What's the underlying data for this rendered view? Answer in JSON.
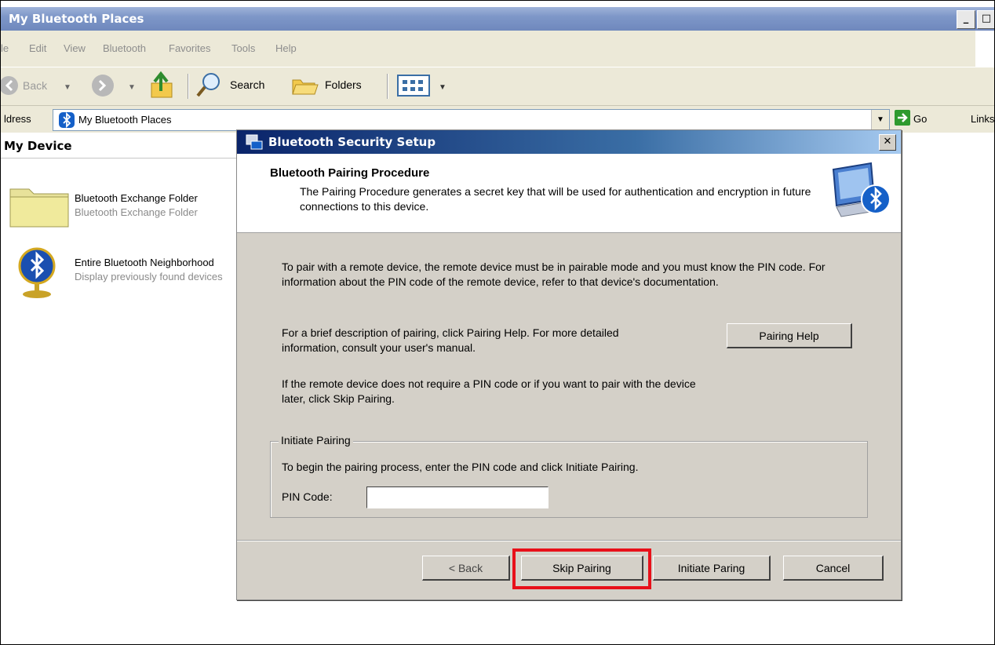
{
  "explorer": {
    "title": "My Bluetooth Places",
    "menu": [
      "le",
      "Edit",
      "View",
      "Bluetooth",
      "Favorites",
      "Tools",
      "Help"
    ],
    "toolbar": {
      "back": "Back",
      "search": "Search",
      "folders": "Folders"
    },
    "address": {
      "label": "ldress",
      "value": "My Bluetooth Places",
      "go": "Go",
      "links": "Links"
    },
    "pane_title": "My Device",
    "items": [
      {
        "name": "Bluetooth Exchange Folder",
        "desc": "Bluetooth Exchange Folder"
      },
      {
        "name": "Entire Bluetooth Neighborhood",
        "desc": "Display previously found devices"
      }
    ]
  },
  "dialog": {
    "title": "Bluetooth Security Setup",
    "header_title": "Bluetooth Pairing Procedure",
    "header_sub": "The Pairing Procedure generates a secret key that will be used for authentication and encryption in future connections to this device.",
    "para1": "To pair with a remote device, the remote device must be in pairable mode and you must know the PIN code.  For information about the PIN code of the remote device, refer to that device's documentation.",
    "para2": "For a brief description of pairing, click Pairing Help.  For more detailed information, consult your user's manual.",
    "para3": "If the remote device does not require a PIN code or if you want to pair with the device later, click Skip Pairing.",
    "pairing_help": "Pairing Help",
    "group_label": "Initiate Pairing",
    "group_text": "To begin the pairing process, enter the PIN code and click Initiate Pairing.",
    "pin_label": "PIN Code:",
    "pin_value": "",
    "buttons": {
      "back": "< Back",
      "skip": "Skip Pairing",
      "initiate": "Initiate Paring",
      "cancel": "Cancel"
    }
  },
  "colors": {
    "highlight": "#e8101a",
    "dialog_title": "#0a246a",
    "bluetooth_blue": "#1560c8"
  }
}
